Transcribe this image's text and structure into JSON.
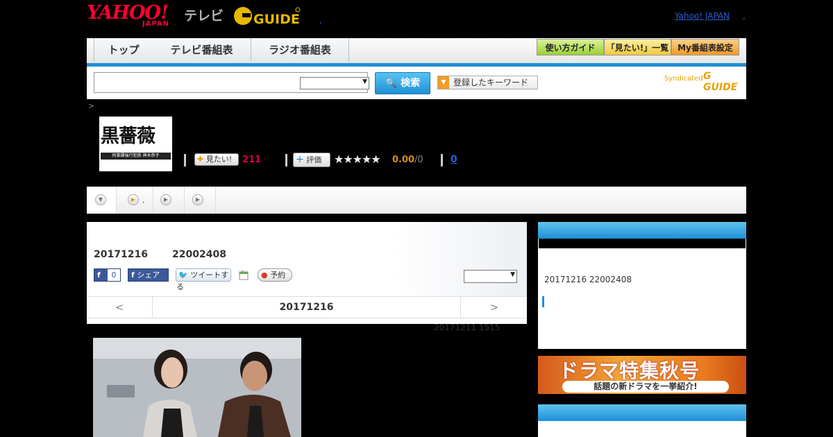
{
  "header": {
    "yahoo_logo_main": "YAHOO!",
    "yahoo_logo_sub": "JAPAN",
    "tv_label": "テレビ",
    "gguide_logo": "G GUIDE",
    "yahoo_japan_link": "Yahoo! JAPAN",
    "link_separator": ",",
    "blue_dot": ","
  },
  "nav": {
    "tabs": [
      {
        "label": "トップ"
      },
      {
        "label": "テレビ番組表"
      },
      {
        "label": "ラジオ番組表"
      }
    ],
    "guide_buttons": [
      {
        "label": "使い方ガイド",
        "color": "#b6e05a"
      },
      {
        "label": "「見たい!」一覧",
        "color": "#f7d75c"
      },
      {
        "label": "My番組表設定",
        "color": "#f3a538"
      }
    ],
    "accent": "#1e8fd6"
  },
  "search": {
    "input_value": "",
    "button_label": "検索",
    "keyword_button": "登録したキーワード",
    "syndicated": "Syndicated",
    "syndicated_logo": "G GUIDE"
  },
  "breadcrumb": {
    "arrow": ">"
  },
  "program": {
    "thumb_title": "黒薔薇",
    "thumb_caption": "刑事課強行犯係 神木恭子",
    "mitai_label": "見たい!",
    "mitai_count": "211",
    "hyouka_label": "評価",
    "stars": "★★★★★",
    "rating": "0.00",
    "rating_count": "/0",
    "review_count": "0"
  },
  "subtabs": {
    "dot": ","
  },
  "main": {
    "air_date": "20171216",
    "air_id": "22002408",
    "fb_label": "f",
    "fb_count": "0",
    "share_label": "シェア",
    "tweet_label": "ツイートする",
    "yoyaku_label": "予約",
    "pager_prev": "<",
    "pager_date": "20171216",
    "pager_next": ">",
    "updated": "20171211  1515"
  },
  "sidebar": {
    "info_text": "20171216  22002408",
    "banner_title": "ドラマ特集秋号",
    "banner_sub": "話題の新ドラマを一挙紹介!"
  }
}
